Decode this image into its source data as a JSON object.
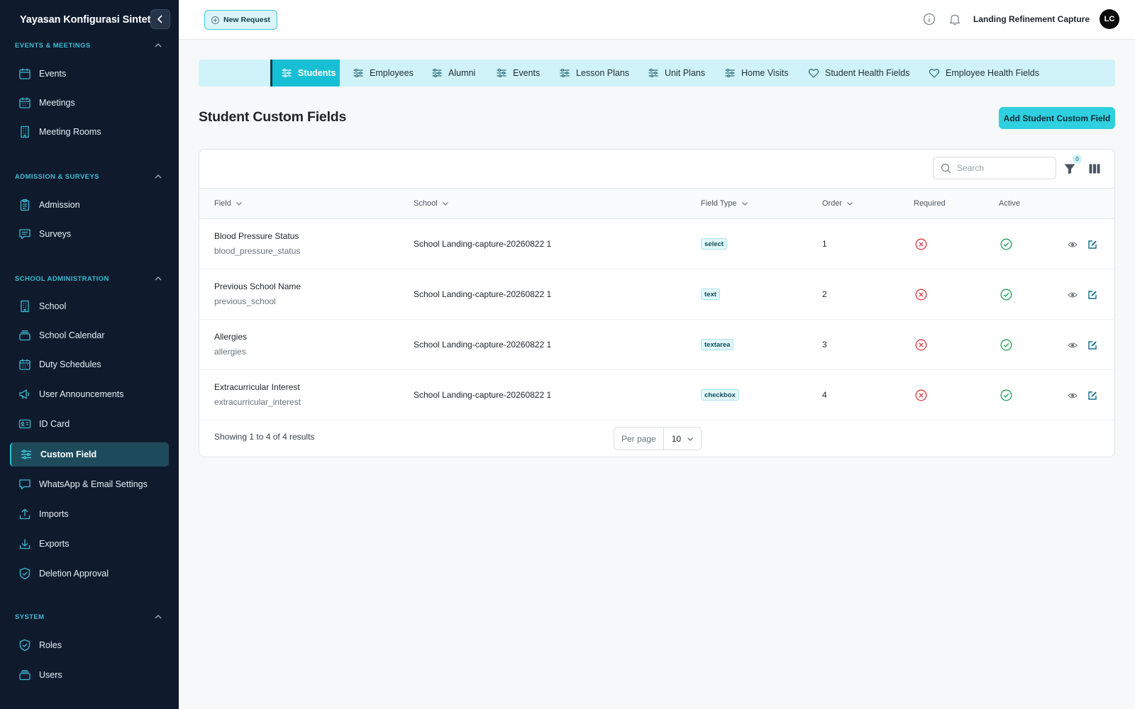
{
  "sidebar": {
    "brand": "Yayasan Konfigurasi Sintetis",
    "sections": [
      {
        "label": "EVENTS & MEETINGS",
        "items": [
          {
            "label": "Events",
            "icon": "calendar-icon"
          },
          {
            "label": "Meetings",
            "icon": "calendar-grid-icon"
          },
          {
            "label": "Meeting Rooms",
            "icon": "building-icon"
          }
        ]
      },
      {
        "label": "ADMISSION & SURVEYS",
        "items": [
          {
            "label": "Admission",
            "icon": "clipboard-icon"
          },
          {
            "label": "Surveys",
            "icon": "chat-icon"
          }
        ]
      },
      {
        "label": "SCHOOL ADMINISTRATION",
        "items": [
          {
            "label": "School",
            "icon": "building-icon"
          },
          {
            "label": "School Calendar",
            "icon": "stack-icon"
          },
          {
            "label": "Duty Schedules",
            "icon": "calendar-grid-icon"
          },
          {
            "label": "User Announcements",
            "icon": "megaphone-icon"
          },
          {
            "label": "ID Card",
            "icon": "id-card-icon"
          },
          {
            "label": "Custom Field",
            "icon": "sliders-icon"
          },
          {
            "label": "WhatsApp & Email Settings",
            "icon": "chat-icon"
          },
          {
            "label": "Imports",
            "icon": "upload-icon"
          },
          {
            "label": "Exports",
            "icon": "download-icon"
          },
          {
            "label": "Deletion Approval",
            "icon": "shield-check-icon"
          }
        ]
      },
      {
        "label": "SYSTEM",
        "items": [
          {
            "label": "Roles",
            "icon": "shield-check-icon"
          },
          {
            "label": "Users",
            "icon": "stack-icon"
          }
        ]
      }
    ],
    "active": "Custom Field"
  },
  "topbar": {
    "new_request": "New Request",
    "user_name": "Landing Refinement Capture",
    "avatar_initials": "LC"
  },
  "tabs": [
    {
      "label": "Students",
      "icon": "sliders-icon"
    },
    {
      "label": "Employees",
      "icon": "sliders-icon"
    },
    {
      "label": "Alumni",
      "icon": "sliders-icon"
    },
    {
      "label": "Events",
      "icon": "sliders-icon"
    },
    {
      "label": "Lesson Plans",
      "icon": "sliders-icon"
    },
    {
      "label": "Unit Plans",
      "icon": "sliders-icon"
    },
    {
      "label": "Home Visits",
      "icon": "sliders-icon"
    },
    {
      "label": "Student Health Fields",
      "icon": "heart-icon"
    },
    {
      "label": "Employee Health Fields",
      "icon": "heart-icon"
    }
  ],
  "page": {
    "title": "Student Custom Fields",
    "add_button": "Add Student Custom Field"
  },
  "table": {
    "search_placeholder": "Search",
    "filter_count": "0",
    "columns": [
      "Field",
      "School",
      "Field Type",
      "Order",
      "Required",
      "Active"
    ],
    "rows": [
      {
        "name": "Blood Pressure Status",
        "key": "blood_pressure_status",
        "school": "School Landing-capture-20260822 1",
        "type": "select",
        "order": "1",
        "required": false,
        "active": true
      },
      {
        "name": "Previous School Name",
        "key": "previous_school",
        "school": "School Landing-capture-20260822 1",
        "type": "text",
        "order": "2",
        "required": false,
        "active": true
      },
      {
        "name": "Allergies",
        "key": "allergies",
        "school": "School Landing-capture-20260822 1",
        "type": "textarea",
        "order": "3",
        "required": false,
        "active": true
      },
      {
        "name": "Extracurricular Interest",
        "key": "extracurricular_interest",
        "school": "School Landing-capture-20260822 1",
        "type": "checkbox",
        "order": "4",
        "required": false,
        "active": true
      }
    ],
    "summary": "Showing 1 to 4 of 4 results",
    "per_page_label": "Per page",
    "per_page_value": "10"
  },
  "colors": {
    "sidebar_bg": "#0f1b2d",
    "accent": "#2fd0e0",
    "required_no": "#d9363e",
    "active_yes": "#1f9d55"
  }
}
